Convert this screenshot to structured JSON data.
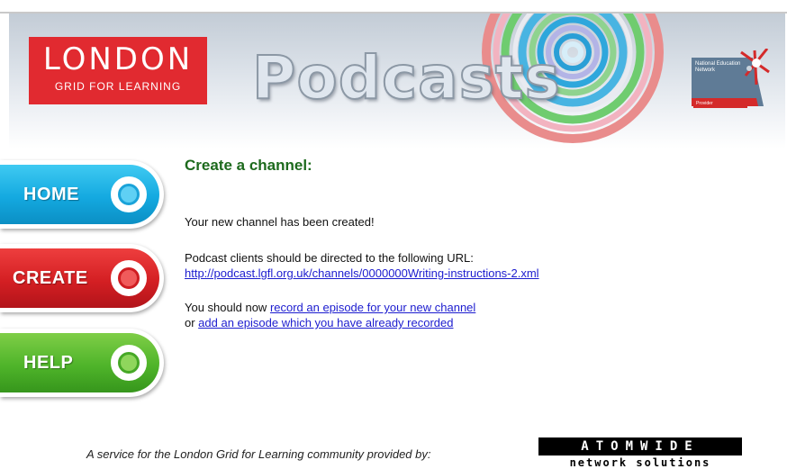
{
  "header": {
    "logo_main": "LONDON",
    "logo_sub": "GRID FOR LEARNING",
    "title": "Podcasts",
    "nen_text": "National Education Network",
    "nen_badge": "Provider"
  },
  "nav": {
    "home_label": "HOME",
    "create_label": "CREATE",
    "help_label": "HELP"
  },
  "main": {
    "heading": "Create a channel:",
    "created_message": "Your new channel has been created!",
    "directed_text": "Podcast clients should be directed to the following URL:",
    "channel_url": "http://podcast.lgfl.org.uk/channels/0000000Writing-instructions-2.xml",
    "should_now_prefix": "You should now ",
    "record_link": "record an episode for your new channel",
    "or_prefix": "or ",
    "add_link": "add an episode which you have already recorded"
  },
  "footer": {
    "service_text": "A service for the London Grid for Learning community provided by:",
    "atomwide_top": "ATOMWIDE",
    "atomwide_bottom": "network solutions"
  },
  "colors": {
    "home": "#14a9e0",
    "create": "#d41f23",
    "help": "#4fb42a",
    "heading": "#1d6a1d",
    "link": "#1c1ccf",
    "logo_red": "#e12a30"
  }
}
